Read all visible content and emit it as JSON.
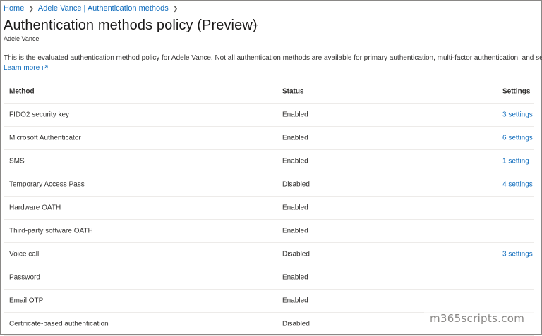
{
  "breadcrumb": [
    {
      "label": "Home"
    },
    {
      "label": "Adele Vance | Authentication methods"
    }
  ],
  "title": "Authentication methods policy (Preview)",
  "more_label": "···",
  "subtitle": "Adele Vance",
  "description": "This is the evaluated authentication method policy for Adele Vance. Not all authentication methods are available for primary authentication, multi-factor authentication, and self ser",
  "learn_more": "Learn more",
  "table": {
    "headers": {
      "method": "Method",
      "status": "Status",
      "settings": "Settings"
    },
    "rows": [
      {
        "method": "FIDO2 security key",
        "status": "Enabled",
        "settings": "3 settings"
      },
      {
        "method": "Microsoft Authenticator",
        "status": "Enabled",
        "settings": "6 settings"
      },
      {
        "method": "SMS",
        "status": "Enabled",
        "settings": "1 setting"
      },
      {
        "method": "Temporary Access Pass",
        "status": "Disabled",
        "settings": "4 settings"
      },
      {
        "method": "Hardware OATH",
        "status": "Enabled",
        "settings": ""
      },
      {
        "method": "Third-party software OATH",
        "status": "Enabled",
        "settings": ""
      },
      {
        "method": "Voice call",
        "status": "Disabled",
        "settings": "3 settings"
      },
      {
        "method": "Password",
        "status": "Enabled",
        "settings": ""
      },
      {
        "method": "Email OTP",
        "status": "Enabled",
        "settings": ""
      },
      {
        "method": "Certificate-based authentication",
        "status": "Disabled",
        "settings": ""
      }
    ]
  },
  "watermark": "m365scripts.com",
  "colors": {
    "link": "#0f6cbd",
    "text": "#323130",
    "divider": "#edebe9"
  }
}
